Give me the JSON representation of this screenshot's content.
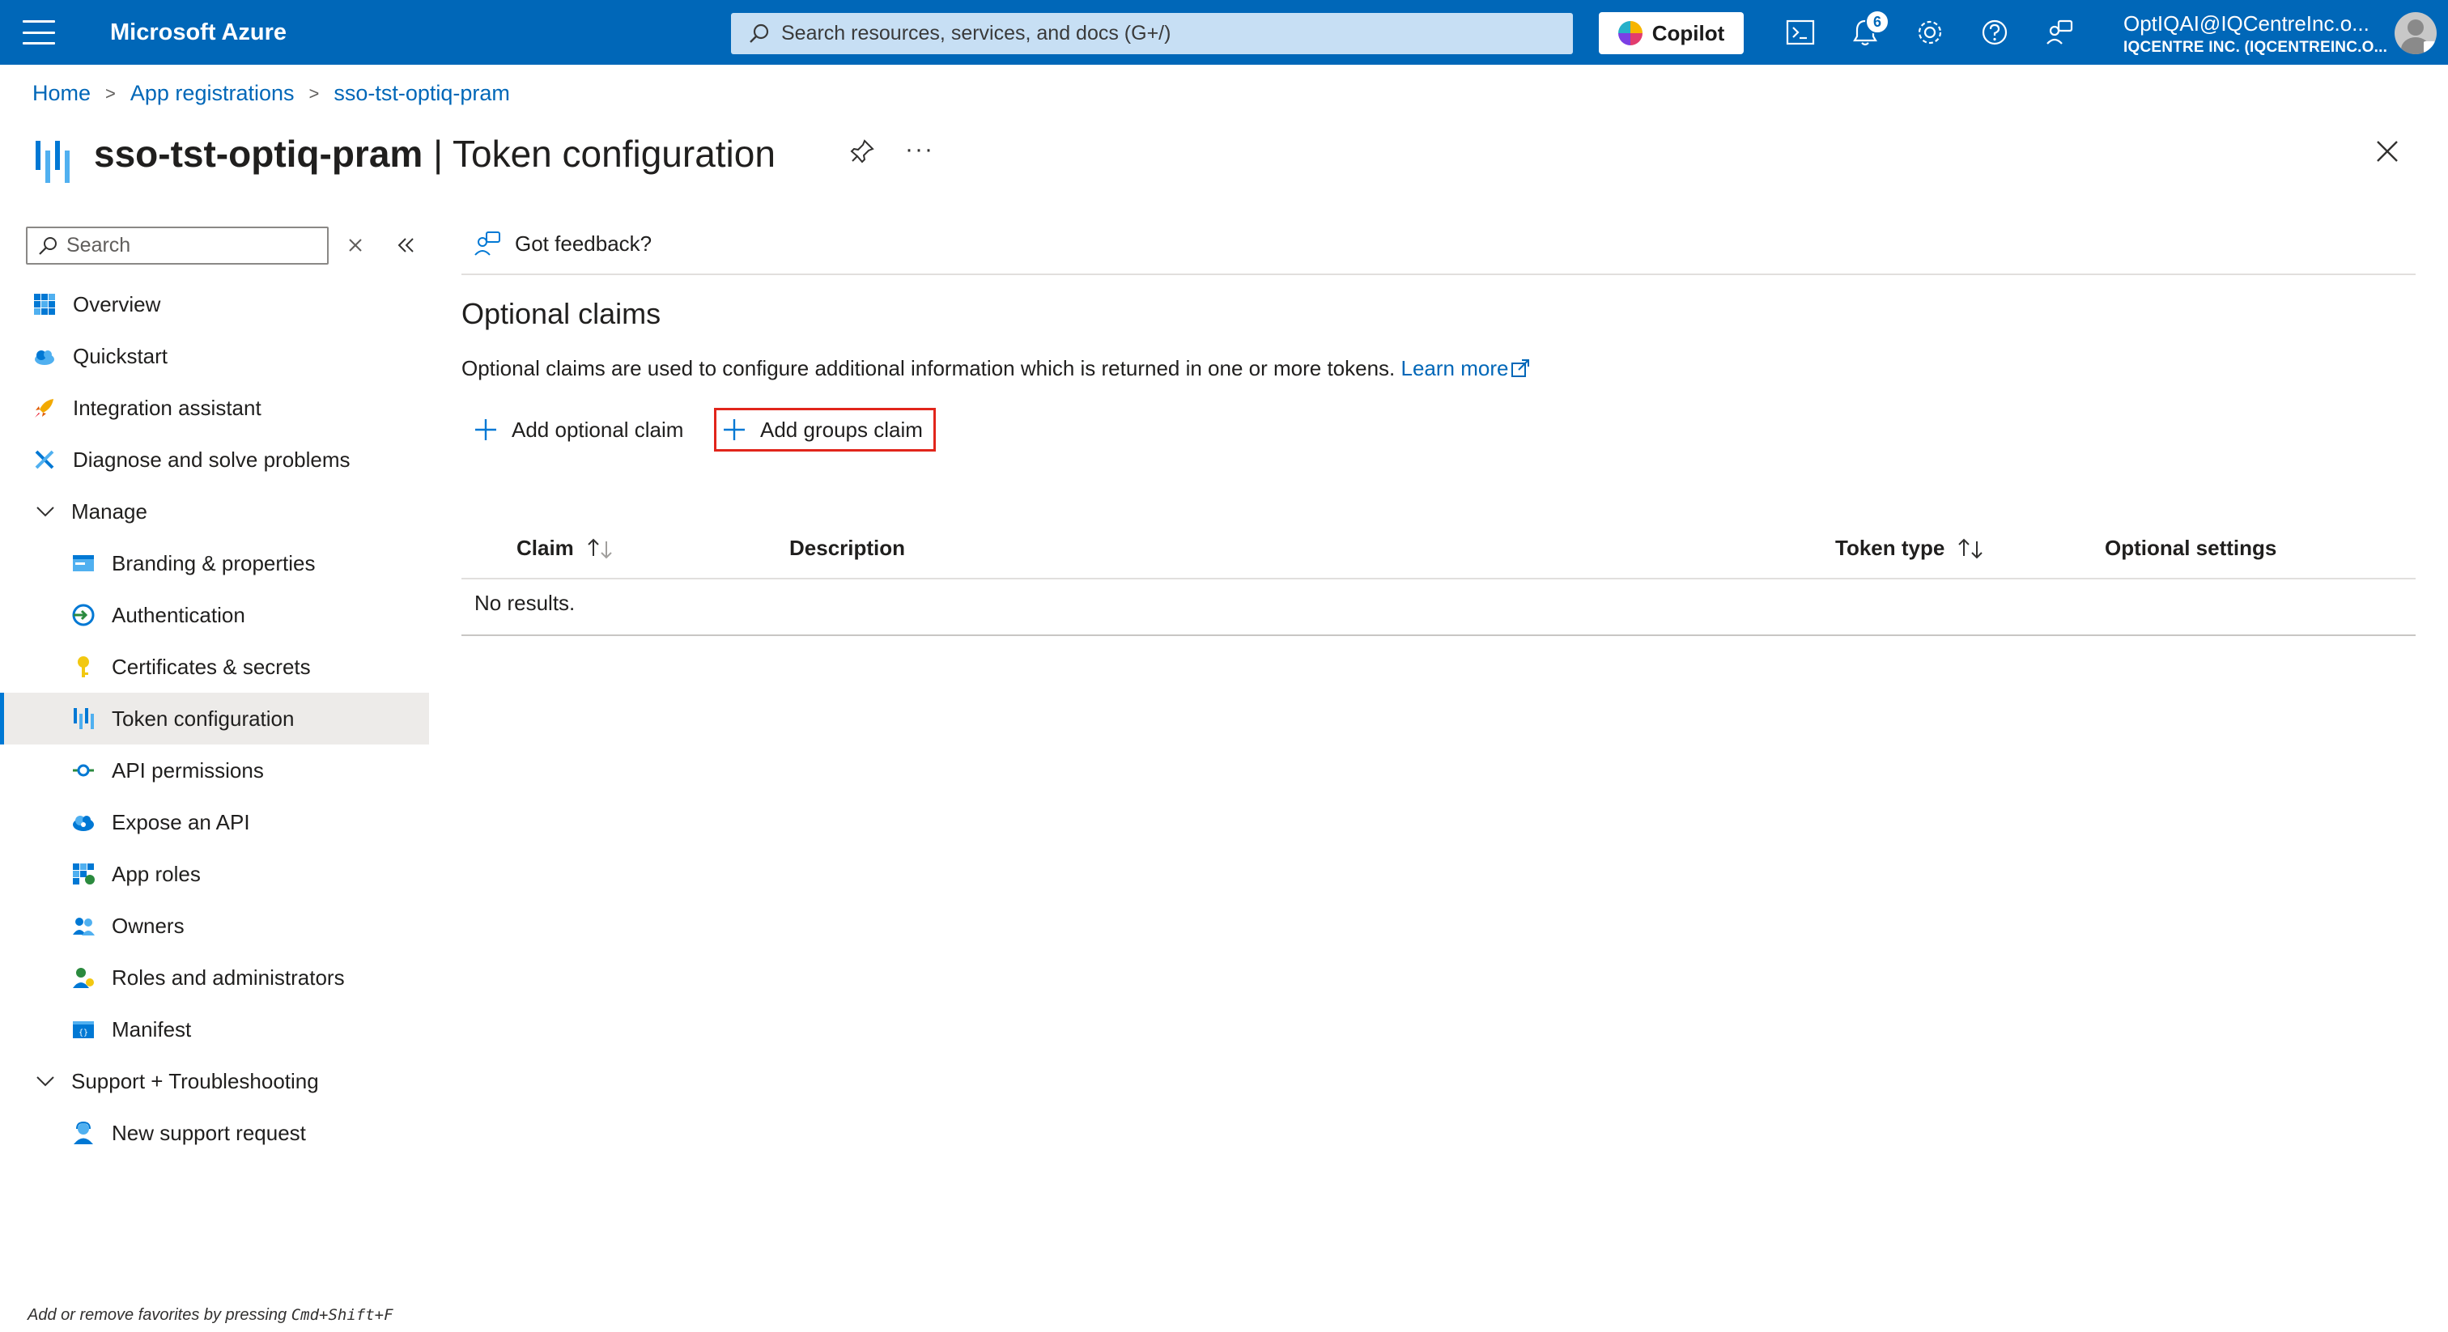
{
  "topbar": {
    "brand": "Microsoft Azure",
    "search_placeholder": "Search resources, services, and docs (G+/)",
    "copilot_label": "Copilot",
    "notifications_count": "6",
    "account_name": "OptIQAI@IQCentreInc.o...",
    "account_tenant": "IQCENTRE INC. (IQCENTREINC.O..."
  },
  "breadcrumb": {
    "items": [
      "Home",
      "App registrations",
      "sso-tst-optiq-pram"
    ]
  },
  "header": {
    "resource_name": "sso-tst-optiq-pram",
    "separator": " | ",
    "blade_name": "Token configuration"
  },
  "nav": {
    "search_placeholder": "Search",
    "items": [
      {
        "label": "Overview",
        "icon": "overview-grid-icon"
      },
      {
        "label": "Quickstart",
        "icon": "quickstart-cloud-icon"
      },
      {
        "label": "Integration assistant",
        "icon": "rocket-icon"
      },
      {
        "label": "Diagnose and solve problems",
        "icon": "wrench-icon"
      },
      {
        "label": "Manage",
        "icon": "chevron-down-icon"
      },
      {
        "label": "Branding & properties",
        "icon": "branding-icon"
      },
      {
        "label": "Authentication",
        "icon": "authentication-icon"
      },
      {
        "label": "Certificates & secrets",
        "icon": "key-icon"
      },
      {
        "label": "Token configuration",
        "icon": "token-bars-icon"
      },
      {
        "label": "API permissions",
        "icon": "api-permissions-icon"
      },
      {
        "label": "Expose an API",
        "icon": "cloud-api-icon"
      },
      {
        "label": "App roles",
        "icon": "app-roles-grid-icon"
      },
      {
        "label": "Owners",
        "icon": "owners-people-icon"
      },
      {
        "label": "Roles and administrators",
        "icon": "person-role-icon"
      },
      {
        "label": "Manifest",
        "icon": "manifest-icon"
      },
      {
        "label": "Support + Troubleshooting",
        "icon": "chevron-down-icon"
      },
      {
        "label": "New support request",
        "icon": "support-person-icon"
      }
    ],
    "active": "Token configuration",
    "favorites_hint_prefix": "Add or remove favorites by pressing ",
    "favorites_hint_keys": "Cmd+Shift+F"
  },
  "main": {
    "feedback_label": "Got feedback?",
    "section_title": "Optional claims",
    "description": "Optional claims are used to configure additional information which is returned in one or more tokens.",
    "learn_more": "Learn more",
    "add_optional_claim": "Add optional claim",
    "add_groups_claim": "Add groups claim",
    "table": {
      "columns": [
        "Claim",
        "Description",
        "Token type",
        "Optional settings"
      ],
      "empty_text": "No results."
    }
  },
  "colors": {
    "topbar": "#0067b8",
    "link": "#0067b8",
    "highlight_box": "#e1251b",
    "active_nav_bg": "#edebe9"
  }
}
